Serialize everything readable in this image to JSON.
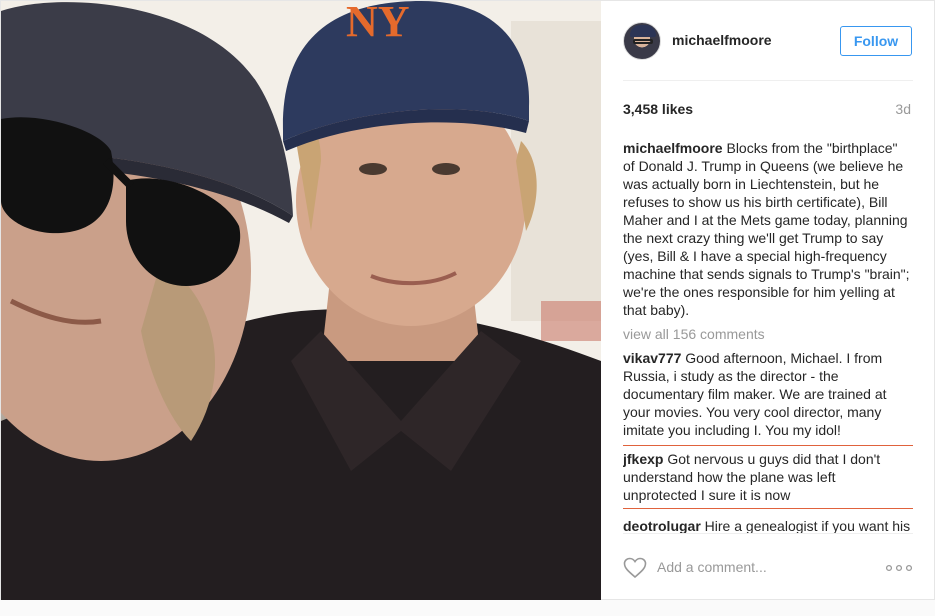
{
  "photo": {
    "icon": "selfie-photo"
  },
  "header": {
    "username": "michaelfmoore",
    "follow_label": "Follow"
  },
  "stats": {
    "likes": "3,458 likes",
    "time": "3d"
  },
  "caption": {
    "user": "michaelfmoore",
    "text": "Blocks from the \"birthplace\" of Donald J. Trump in Queens (we believe he was actually born in Liechtenstein, but he refuses to show us his birth certificate), Bill Maher and I at the Mets game today, planning the next crazy thing we'll get Trump to say (yes, Bill & I have a special high-frequency machine that sends signals to Trump's \"brain\"; we're the ones responsible for him yelling at that baby)."
  },
  "view_all": "view all 156 comments",
  "comments": [
    {
      "user": "vikav777",
      "text": "Good afternoon, Michael. I from Russia, i study as the director - the documentary film maker. We are trained at your movies. You very cool director, many imitate you including I. You my idol!"
    },
    {
      "user": "jfkexp",
      "text": "Got nervous u guys did that I don't understand how the plane was left unprotected I sure it is now"
    },
    {
      "user": "deotrolugar",
      "text": "Hire a genealogist if you want his birth certificate! They are detectives"
    }
  ],
  "footer": {
    "heart_icon": "heart-icon",
    "add_comment_placeholder": "Add a comment...",
    "more_icon": "more-options-icon"
  },
  "colors": {
    "accent": "#3897f0",
    "highlight_border": "#e0623c",
    "muted": "#999999"
  }
}
